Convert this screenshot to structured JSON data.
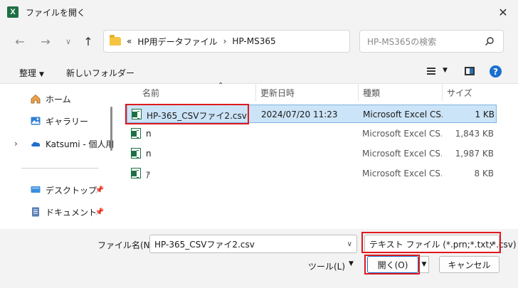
{
  "window": {
    "title": "ファイルを開く",
    "app_icon_letter": "X",
    "close_glyph": "✕"
  },
  "nav": {
    "back_glyph": "←",
    "forward_glyph": "→",
    "recent_glyph": "∨",
    "up_glyph": "↑",
    "breadcrumb_prefix": "«",
    "breadcrumb": [
      "HP用データファイル",
      "HP-MS365"
    ],
    "breadcrumb_sep": "›",
    "search_placeholder": "HP-MS365の検索"
  },
  "toolbar": {
    "organize_label": "整理",
    "new_folder_label": "新しいフォルダー",
    "help_glyph": "?"
  },
  "sidebar": {
    "items": [
      {
        "label": "ホーム",
        "icon": "home-icon"
      },
      {
        "label": "ギャラリー",
        "icon": "gallery-icon"
      },
      {
        "label": "Katsumi - 個人用",
        "icon": "cloud-icon"
      },
      {
        "label": "デスクトップ",
        "icon": "desktop-icon"
      },
      {
        "label": "ドキュメント",
        "icon": "document-icon"
      }
    ]
  },
  "columns": {
    "name": "名前",
    "modified": "更新日時",
    "type": "種類",
    "size": "サイズ"
  },
  "files": [
    {
      "name": "HP-365_CSVファイ2.csv",
      "modified": "2024/07/20 11:23",
      "type": "Microsoft Excel CS...",
      "size": "1 KB"
    },
    {
      "name": "n",
      "modified": "",
      "type": "Microsoft Excel CS...",
      "size": "1,843 KB"
    },
    {
      "name": "n",
      "modified": "",
      "type": "Microsoft Excel CS...",
      "size": "1,987 KB"
    },
    {
      "name": "ｱ",
      "modified": "",
      "type": "Microsoft Excel CS...",
      "size": "8 KB"
    }
  ],
  "footer": {
    "filename_label": "ファイル名(N):",
    "filename_value": "HP-365_CSVファイ2.csv",
    "filetype_value": "テキスト ファイル (*.prn;*.txt;*.csv)",
    "tools_label": "ツール(L)",
    "open_label": "開く(O)",
    "cancel_label": "キャンセル"
  },
  "colors": {
    "highlight": "#e0191d",
    "selection": "#cce4f7",
    "accent": "#1a6fd0",
    "excel_green": "#1d7044"
  }
}
